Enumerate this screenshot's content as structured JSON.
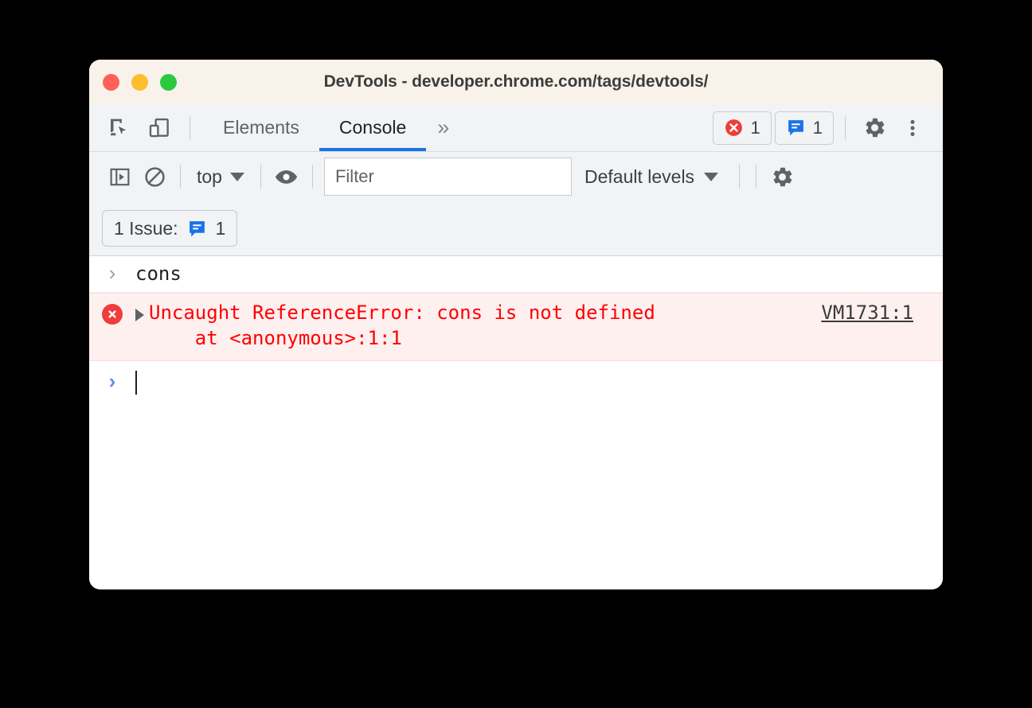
{
  "window": {
    "title": "DevTools - developer.chrome.com/tags/devtools/",
    "traffic_lights": [
      {
        "name": "close",
        "color": "#ff6159"
      },
      {
        "name": "minimize",
        "color": "#ffbd2e"
      },
      {
        "name": "maximize",
        "color": "#2bc840"
      }
    ]
  },
  "main_toolbar": {
    "inspect_icon": "inspect-element-icon",
    "device_icon": "device-toolbar-icon",
    "tabs": [
      {
        "label": "Elements",
        "active": false
      },
      {
        "label": "Console",
        "active": true
      }
    ],
    "more_tabs_label": "»",
    "error_badge": {
      "icon": "error-circle-icon",
      "count": "1",
      "color": "#ef3c3c"
    },
    "issues_badge": {
      "icon": "issues-speech-bubble-icon",
      "count": "1",
      "color": "#1a73e8"
    },
    "settings_icon": "gear-icon",
    "more_options_icon": "three-dots-vertical-icon"
  },
  "console_toolbar": {
    "sidebar_toggle_icon": "console-sidebar-icon",
    "clear_console_icon": "clear-console-icon",
    "context_selector": {
      "label": "top"
    },
    "eye_icon": "live-expression-eye-icon",
    "filter": {
      "placeholder": "Filter",
      "value": ""
    },
    "log_levels": {
      "label": "Default levels"
    },
    "settings_icon": "console-settings-gear-icon"
  },
  "issues_bar": {
    "chip_label": "1 Issue:",
    "chip_icon": "issues-speech-bubble-icon",
    "chip_count": "1"
  },
  "console": {
    "entries": [
      {
        "type": "input",
        "prompt": "›",
        "text": "cons"
      },
      {
        "type": "error",
        "icon": "error-circle-icon",
        "expander": "collapsed-triangle-icon",
        "message_line1": "Uncaught ReferenceError: cons is not defined",
        "message_line2": "    at <anonymous>:1:1",
        "source_link": "VM1731:1"
      },
      {
        "type": "prompt",
        "prompt": "›",
        "text": ""
      }
    ]
  },
  "colors": {
    "accent": "#1a73e8",
    "error": "#ff0000",
    "error_bg": "#fff0f0",
    "toolbar_bg": "#f1f3f4",
    "titlebar_bg": "#f8f2ea"
  }
}
